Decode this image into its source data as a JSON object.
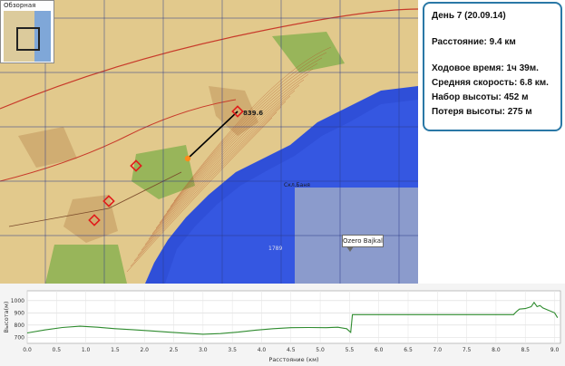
{
  "overview": {
    "title": "Обзорная карта"
  },
  "map": {
    "callout_label": "Ozero Bajkal",
    "labels": {
      "peak": "839.6",
      "coast": "Cкл.Баня",
      "water_depth": "1789"
    },
    "colors": {
      "water": "#2f4fd8",
      "water_inner": "#3a5ee8",
      "grey_overlay": "#9aa7c8",
      "land": "#e2c98c",
      "route": "#000000",
      "marker": "#e11b1b",
      "orange_point": "#ff8a1a"
    }
  },
  "info": {
    "day": "День 7 (20.09.14)",
    "distance": "Расстояние: 9.4 км",
    "moving_time": "Ходовое время: 1ч 39м.",
    "avg_speed": "Средняя скорость: 6.8 км.",
    "ascent": "Набор высоты: 452 м",
    "descent": "Потеря высоты: 275 м"
  },
  "profile": {
    "x_label": "Расстояние (км)",
    "y_label": "Высота(м)",
    "x_ticks": [
      "0.0",
      "0.5",
      "1.0",
      "1.5",
      "2.0",
      "2.5",
      "3.0",
      "3.5",
      "4.0",
      "4.5",
      "5.0",
      "5.5",
      "6.0",
      "6.5",
      "7.0",
      "7.5",
      "8.0",
      "8.5",
      "9.0"
    ],
    "y_ticks": [
      "700",
      "800",
      "900",
      "1000"
    ],
    "line_color": "#2e8b2e"
  },
  "chart_data": {
    "type": "line",
    "xlabel": "Расстояние (км)",
    "ylabel": "Высота(м)",
    "xlim": [
      0,
      9.1
    ],
    "ylim": [
      650,
      1080
    ],
    "series": [
      {
        "x": [
          0.0,
          0.3,
          0.6,
          0.9,
          1.2,
          1.5,
          1.8,
          2.1,
          2.4,
          2.7,
          3.0,
          3.3,
          3.6,
          3.9,
          4.2,
          4.5,
          4.8,
          5.1,
          5.3,
          5.45,
          5.52,
          5.55,
          5.6,
          6.0,
          6.5,
          7.0,
          7.5,
          8.0,
          8.3,
          8.35,
          8.4,
          8.5,
          8.6,
          8.65,
          8.7,
          8.75,
          8.8,
          8.9,
          9.0,
          9.05
        ],
        "y": [
          735,
          760,
          780,
          790,
          782,
          770,
          762,
          752,
          742,
          733,
          725,
          730,
          742,
          758,
          770,
          778,
          780,
          778,
          782,
          770,
          740,
          885,
          885,
          885,
          885,
          885,
          885,
          885,
          885,
          910,
          930,
          935,
          950,
          985,
          950,
          960,
          940,
          920,
          900,
          860
        ]
      }
    ]
  }
}
